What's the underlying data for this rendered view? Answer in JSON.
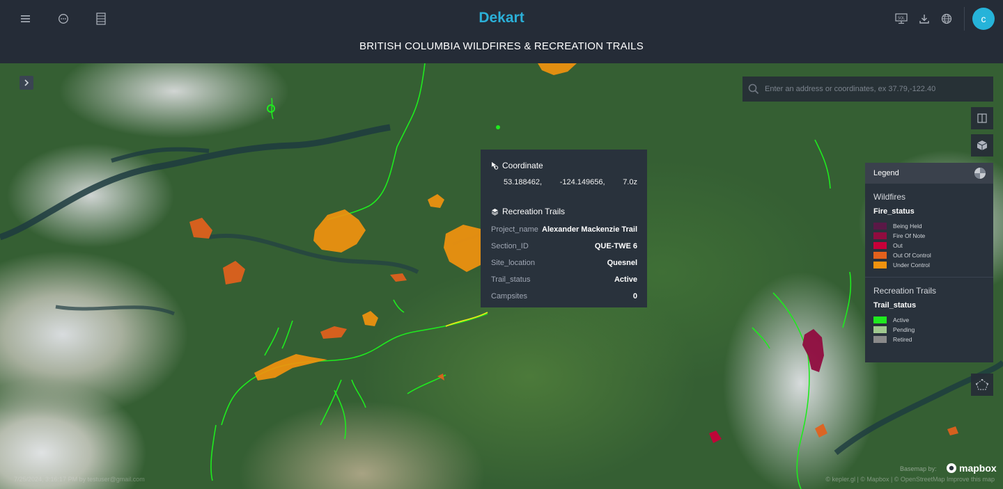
{
  "header": {
    "app_name": "Dekart",
    "report_title": "BRITISH COLUMBIA WILDFIRES & RECREATION TRAILS",
    "avatar_initial": "c",
    "left_icons": [
      "menu-icon",
      "chat-icon",
      "grid-icon"
    ],
    "right_icons": [
      "sql-icon",
      "download-icon",
      "globe-icon"
    ]
  },
  "colors": {
    "brand": "#2bb0d8",
    "header_bg": "#252c37",
    "panel_bg": "#29323c"
  },
  "map": {
    "search_placeholder": "Enter an address or coordinates, ex 37.79,-122.40",
    "controls": [
      "split-map-icon",
      "3d-icon",
      "draw-polygon-icon"
    ],
    "footer_left": "7/25/2024, 3:16:17 PM by testuser@gmail.com",
    "footer_right": "© kepler.gl | © Mapbox | © OpenStreetMap  Improve this map",
    "basemap_label": "Basemap by:",
    "mapbox_label": "mapbox"
  },
  "tooltip": {
    "coordinate_title": "Coordinate",
    "lat": "53.188462,",
    "lng": "-124.149656,",
    "zoom": "7.0z",
    "layer_title": "Recreation Trails",
    "rows": [
      {
        "key": "Project_name",
        "value": "Alexander Mackenzie Trail"
      },
      {
        "key": "Section_ID",
        "value": "QUE-TWE 6"
      },
      {
        "key": "Site_location",
        "value": "Quesnel"
      },
      {
        "key": "Trail_status",
        "value": "Active"
      },
      {
        "key": "Campsites",
        "value": "0"
      }
    ]
  },
  "legend": {
    "title": "Legend",
    "sections": [
      {
        "layer": "Wildfires",
        "field": "Fire_status",
        "items": [
          {
            "label": "Being Held",
            "color": "#5a1846"
          },
          {
            "label": "Fire Of Note",
            "color": "#900c3f"
          },
          {
            "label": "Out",
            "color": "#c70039"
          },
          {
            "label": "Out Of Control",
            "color": "#e3611c"
          },
          {
            "label": "Under Control",
            "color": "#f1920e"
          }
        ]
      },
      {
        "layer": "Recreation Trails",
        "field": "Trail_status",
        "items": [
          {
            "label": "Active",
            "color": "#1fea1f"
          },
          {
            "label": "Pending",
            "color": "#a0c98f"
          },
          {
            "label": "Retired",
            "color": "#8a8a8a"
          }
        ]
      }
    ]
  }
}
